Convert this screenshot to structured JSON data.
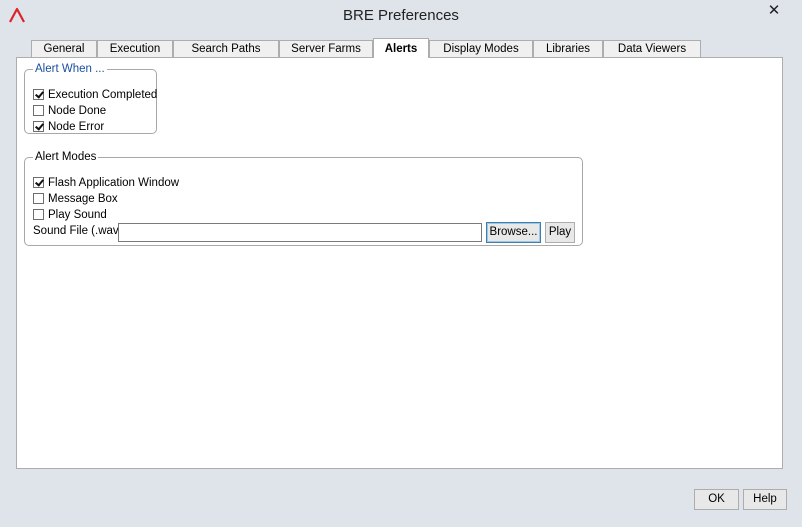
{
  "window": {
    "title": "BRE Preferences",
    "close_symbol": "✕",
    "app_icon": "bre-logo-icon",
    "accent_color": "#d9262b"
  },
  "tabs": [
    {
      "label": "General",
      "active": false
    },
    {
      "label": "Execution",
      "active": false
    },
    {
      "label": "Search Paths",
      "active": false
    },
    {
      "label": "Server Farms",
      "active": false
    },
    {
      "label": "Alerts",
      "active": true
    },
    {
      "label": "Display Modes",
      "active": false
    },
    {
      "label": "Libraries",
      "active": false
    },
    {
      "label": "Data Viewers",
      "active": false
    }
  ],
  "alert_when": {
    "legend": "Alert When ...",
    "items": [
      {
        "label": "Execution Completed",
        "checked": true
      },
      {
        "label": "Node Done",
        "checked": false
      },
      {
        "label": "Node Error",
        "checked": true
      }
    ]
  },
  "alert_modes": {
    "legend": "Alert Modes",
    "items": [
      {
        "label": "Flash Application Window",
        "checked": true
      },
      {
        "label": "Message Box",
        "checked": false
      },
      {
        "label": "Play Sound",
        "checked": false
      }
    ],
    "sound_file_label": "Sound File (.wav):",
    "sound_file_value": "",
    "browse_label": "Browse...",
    "play_label": "Play"
  },
  "footer": {
    "ok_label": "OK",
    "help_label": "Help"
  }
}
